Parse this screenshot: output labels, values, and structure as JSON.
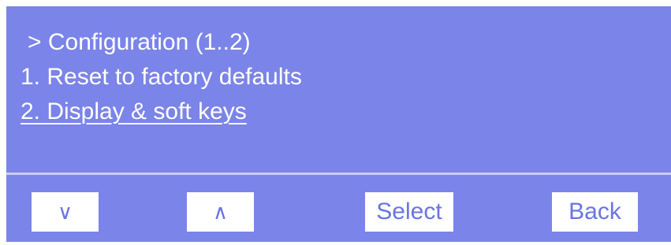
{
  "menu": {
    "title": "> Configuration (1..2)",
    "items": [
      {
        "label": "1. Reset to factory defaults",
        "selected": false
      },
      {
        "label": "2. Display & soft keys",
        "selected": true
      }
    ]
  },
  "softkeys": {
    "down": "∨",
    "up": "∧",
    "select": "Select",
    "back": "Back"
  },
  "colors": {
    "screen_background": "#7b84e8",
    "text": "#ffffff",
    "key_text": "#6a74e2",
    "divider": "#c9cdf6"
  }
}
